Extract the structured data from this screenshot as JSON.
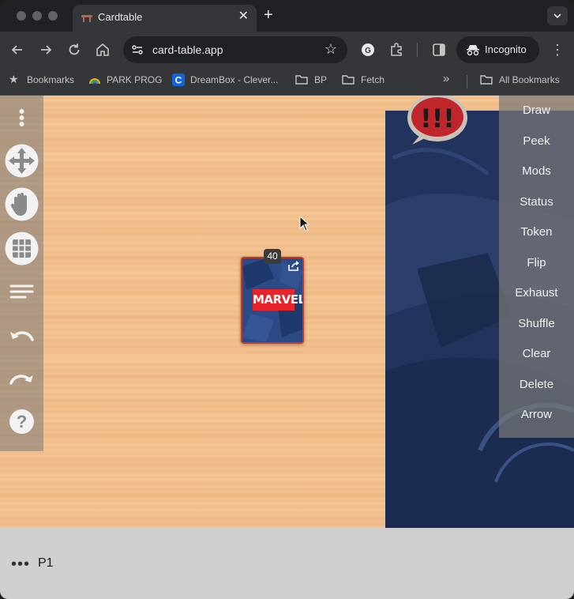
{
  "browser": {
    "tab_title": "Cardtable",
    "tab_close": "✕",
    "new_tab": "+",
    "tab_menu": "⌄",
    "url": "card-table.app",
    "profile_label": "Incognito"
  },
  "bookmarks": {
    "items": [
      {
        "label": "Bookmarks",
        "icon": "star-icon"
      },
      {
        "label": "PARK PROG",
        "icon": "rainbow-icon"
      },
      {
        "label": "DreamBox - Clever...",
        "icon": "clever-icon"
      },
      {
        "label": "BP",
        "icon": "folder-icon"
      },
      {
        "label": "Fetch",
        "icon": "folder-icon"
      }
    ],
    "overflow": "»",
    "all_bookmarks": "All Bookmarks"
  },
  "table": {
    "deck_count": "40",
    "deck_logo": "MARVEL"
  },
  "side_menu": {
    "items": [
      "Draw",
      "Peek",
      "Mods",
      "Status",
      "Token",
      "Flip",
      "Exhaust",
      "Shuffle",
      "Clear",
      "Delete",
      "Arrow"
    ]
  },
  "left_toolbar": {
    "items": [
      "more-icon",
      "move-icon",
      "hand-icon",
      "grid-icon",
      "list-icon",
      "undo-icon",
      "redo-icon",
      "help-icon"
    ],
    "help_label": "?"
  },
  "bottom_bar": {
    "dots": "•••",
    "player_label": "P1"
  },
  "colors": {
    "table_wood": "#f5c898",
    "panel_blue": "#23345c",
    "menu_gray": "#787878",
    "card_border": "#c0392b",
    "marvel_red": "#e62429"
  }
}
